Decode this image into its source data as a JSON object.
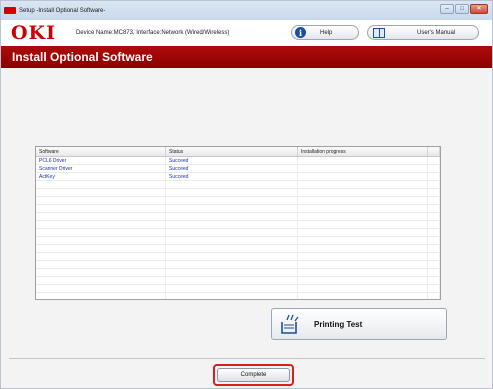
{
  "window": {
    "title": "Setup -Install Optional Software-",
    "controls": {
      "minimize": "–",
      "maximize": "□",
      "close": "✕"
    }
  },
  "header": {
    "logo": "OKI",
    "device_info": "Device Name:MC873, Interface:Network (Wired/Wireless)",
    "help_label": "Help",
    "help_icon_glyph": "i",
    "manual_label": "User's Manual"
  },
  "banner": {
    "title": "Install Optional Software"
  },
  "table": {
    "headers": [
      "Software",
      "Status",
      "Installation progress"
    ],
    "rows": [
      {
        "software": "PCL6 Driver",
        "status": "Succeed",
        "progress": ""
      },
      {
        "software": "Scanner Driver",
        "status": "Succeed",
        "progress": ""
      },
      {
        "software": "ActKey",
        "status": "Succeed",
        "progress": ""
      }
    ]
  },
  "print_test": {
    "label": "Printing Test"
  },
  "complete": {
    "label": "Complete"
  },
  "colors": {
    "brand_red": "#cc0000",
    "banner_red": "#a00808",
    "link_blue": "#1a2fb0",
    "highlight": "#d42020"
  }
}
